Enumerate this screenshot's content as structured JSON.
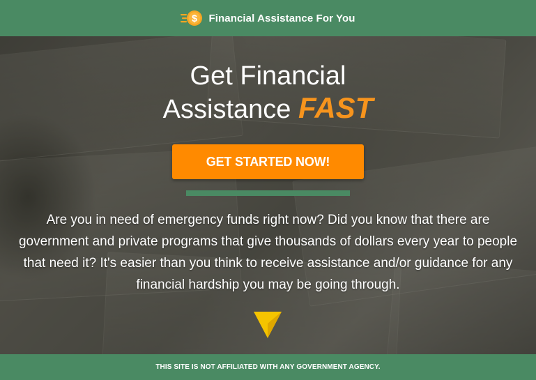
{
  "header": {
    "brand_name": "Financial Assistance For You",
    "logo_symbol": "$",
    "logo_icon": "dollar-coin-icon",
    "background": "#4a8a63"
  },
  "hero": {
    "headline_line1": "Get Financial",
    "headline_line2": "Assistance",
    "headline_accent": "FAST",
    "accent_color": "#f7941d",
    "cta_label": "GET STARTED NOW!",
    "cta_color": "#ff8a00",
    "body": "Are you in need of emergency funds right now? Did you know that there are government and private programs that give thousands of dollars every year to people that need it? It's easier than you think to receive assistance and/or guidance for any financial hardship you may be going through.",
    "scroll_icon": "arrow-down-icon",
    "arrow_color": "#f5c400"
  },
  "footer": {
    "disclaimer": "THIS SITE IS NOT AFFILIATED WITH ANY GOVERNMENT AGENCY."
  }
}
